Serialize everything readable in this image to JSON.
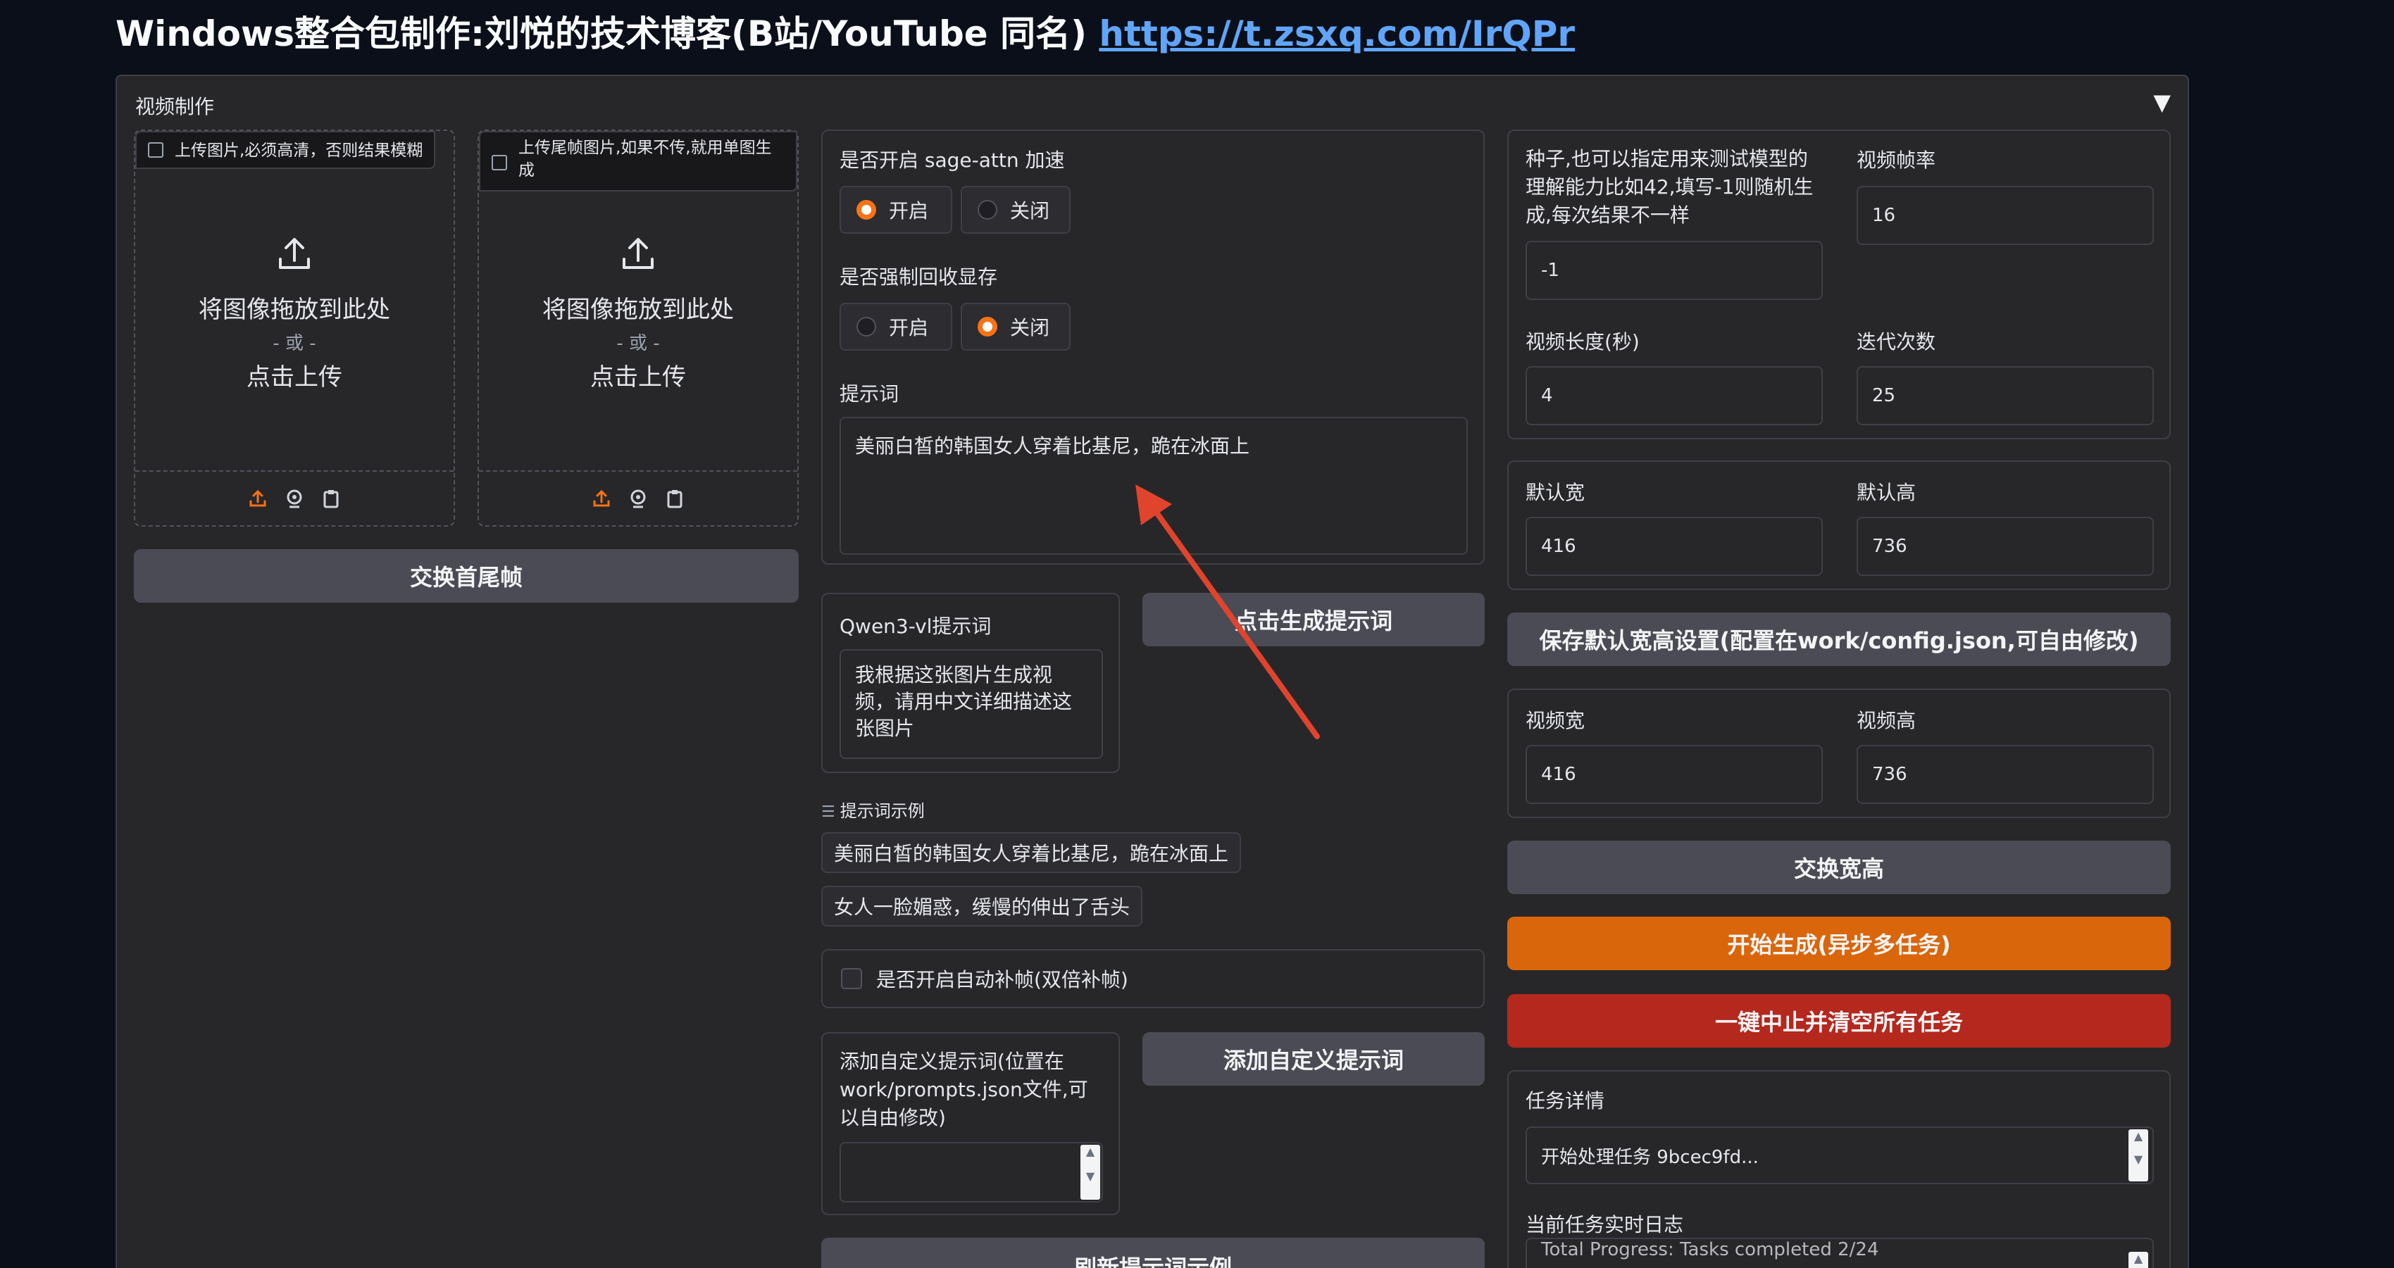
{
  "header": {
    "title": "Windows整合包制作:刘悦的技术博客(B站/YouTube 同名)",
    "link": "https://t.zsxq.com/IrQPr"
  },
  "accordion": {
    "label": "视频制作",
    "arrow": "▼"
  },
  "upload_first": {
    "tag": "上传图片,必须高清，否则结果模糊",
    "drop": "将图像拖放到此处",
    "or": "- 或 -",
    "click": "点击上传"
  },
  "upload_last": {
    "tag": "上传尾帧图片,如果不传,就用单图生成",
    "drop": "将图像拖放到此处",
    "or": "- 或 -",
    "click": "点击上传"
  },
  "swap_frames_button": "交换首尾帧",
  "sage_attn": {
    "label": "是否开启 sage-attn 加速",
    "on": "开启",
    "off": "关闭",
    "selected": "开启"
  },
  "force_gc": {
    "label": "是否强制回收显存",
    "on": "开启",
    "off": "关闭",
    "selected": "关闭"
  },
  "prompt": {
    "label": "提示词",
    "value": "美丽白皙的韩国女人穿着比基尼，跪在冰面上"
  },
  "qwen": {
    "label": "Qwen3-vl提示词",
    "value": "我根据这张图片生成视频，请用中文详细描述这张图片"
  },
  "gen_prompt_button": "点击生成提示词",
  "examples": {
    "label": "提示词示例",
    "items": [
      "美丽白皙的韩国女人穿着比基尼，跪在冰面上",
      "女人一脸媚惑，缓慢的伸出了舌头"
    ]
  },
  "interp": {
    "label": "是否开启自动补帧(双倍补帧)"
  },
  "custom_prompt": {
    "label": "添加自定义提示词(位置在work/prompts.json文件,可以自由修改)",
    "button": "添加自定义提示词"
  },
  "refresh_button": "刷新提示词示例",
  "seed": {
    "label": "种子,也可以指定用来测试模型的理解能力比如42,填写-1则随机生成,每次结果不一样",
    "value": "-1"
  },
  "fps": {
    "label": "视频帧率",
    "value": "16"
  },
  "length": {
    "label": "视频长度(秒)",
    "value": "4"
  },
  "steps": {
    "label": "迭代次数",
    "value": "25"
  },
  "default_w": {
    "label": "默认宽",
    "value": "416"
  },
  "default_h": {
    "label": "默认高",
    "value": "736"
  },
  "save_default_button": "保存默认宽高设置(配置在work/config.json,可自由修改)",
  "video_w": {
    "label": "视频宽",
    "value": "416"
  },
  "video_h": {
    "label": "视频高",
    "value": "736"
  },
  "swap_wh_button": "交换宽高",
  "start_button": "开始生成(异步多任务)",
  "stop_button": "一键中止并清空所有任务",
  "task_detail": {
    "label": "任务详情",
    "value": "开始处理任务 9bcec9fd..."
  },
  "log": {
    "label": "当前任务实时日志",
    "value": "Total Progress: Tasks completed 2/24"
  },
  "colors": {
    "accent": "#d9660a",
    "danger": "#b4281e",
    "link": "#60a5fa"
  }
}
